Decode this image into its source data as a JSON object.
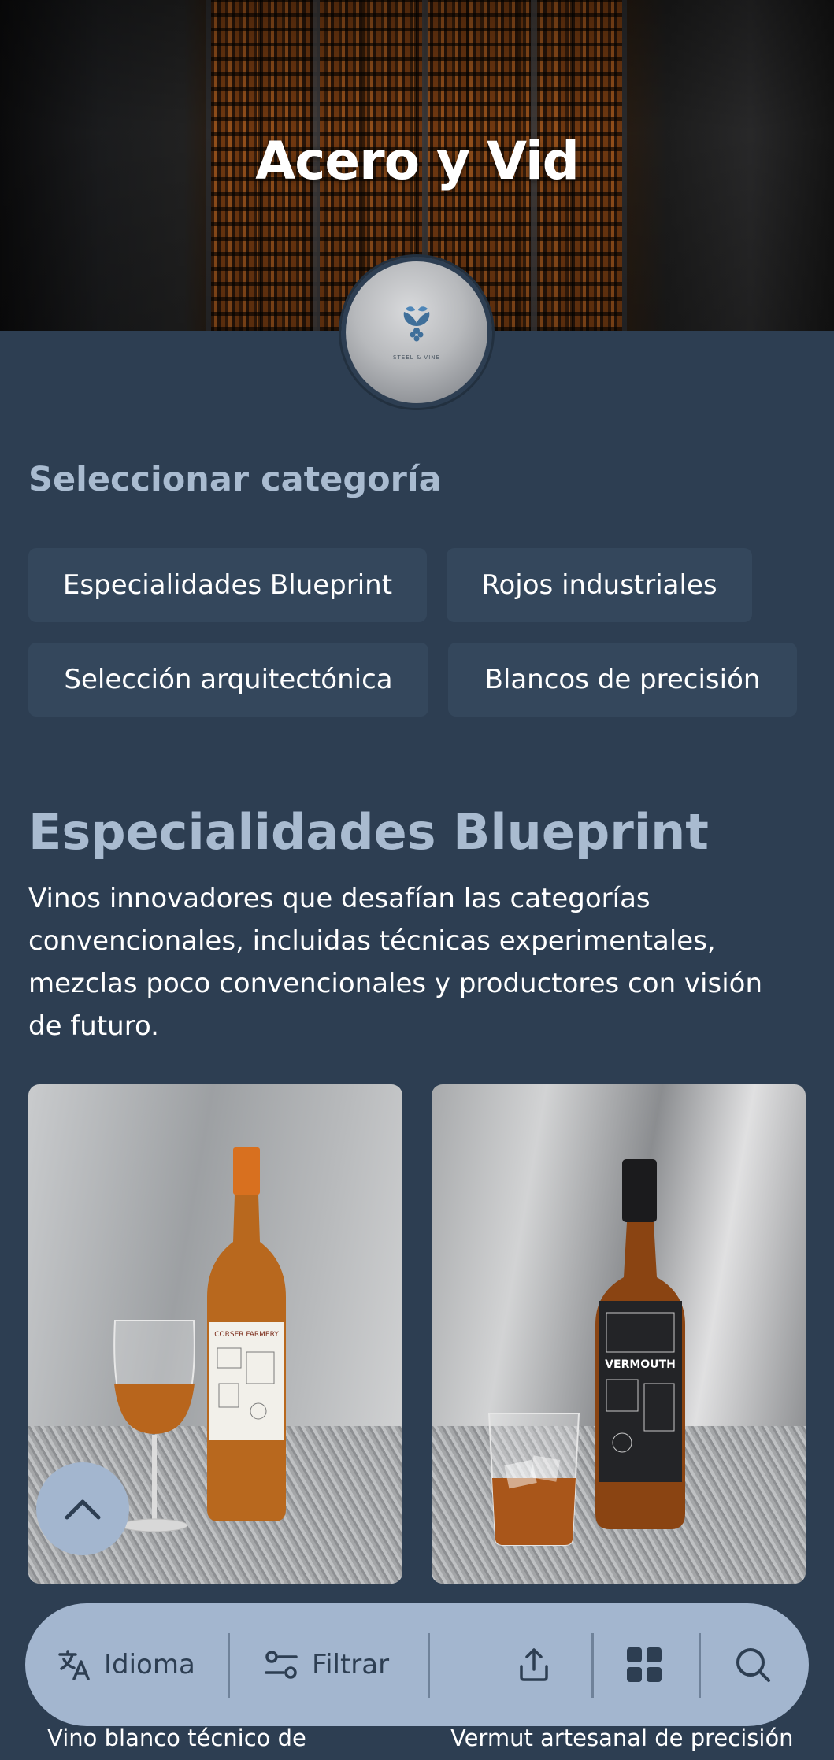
{
  "hero": {
    "title": "Acero y Vid"
  },
  "logo": {
    "text": "STEEL & VINE"
  },
  "categories": {
    "label": "Seleccionar categoría",
    "items": [
      "Especialidades Blueprint",
      "Rojos industriales",
      "Selección arquitectónica",
      "Blancos de precisión"
    ]
  },
  "section": {
    "title": "Especialidades Blueprint",
    "description": "Vinos innovadores que desafían las categorías convencionales, incluidas técnicas experimentales, mezclas poco convencionales y productores con visión de futuro."
  },
  "products": [
    {
      "title": "Vino blanco técnico de",
      "label_text": "CORSER FARMERY"
    },
    {
      "title": "Vermut artesanal de precisión",
      "label_text": "VERMOUTH"
    }
  ],
  "toolbar": {
    "language_label": "Idioma",
    "filter_label": "Filtrar"
  },
  "icons": [
    "translate-icon",
    "filter-icon",
    "share-icon",
    "grid-icon",
    "search-icon",
    "chevron-up-icon"
  ]
}
